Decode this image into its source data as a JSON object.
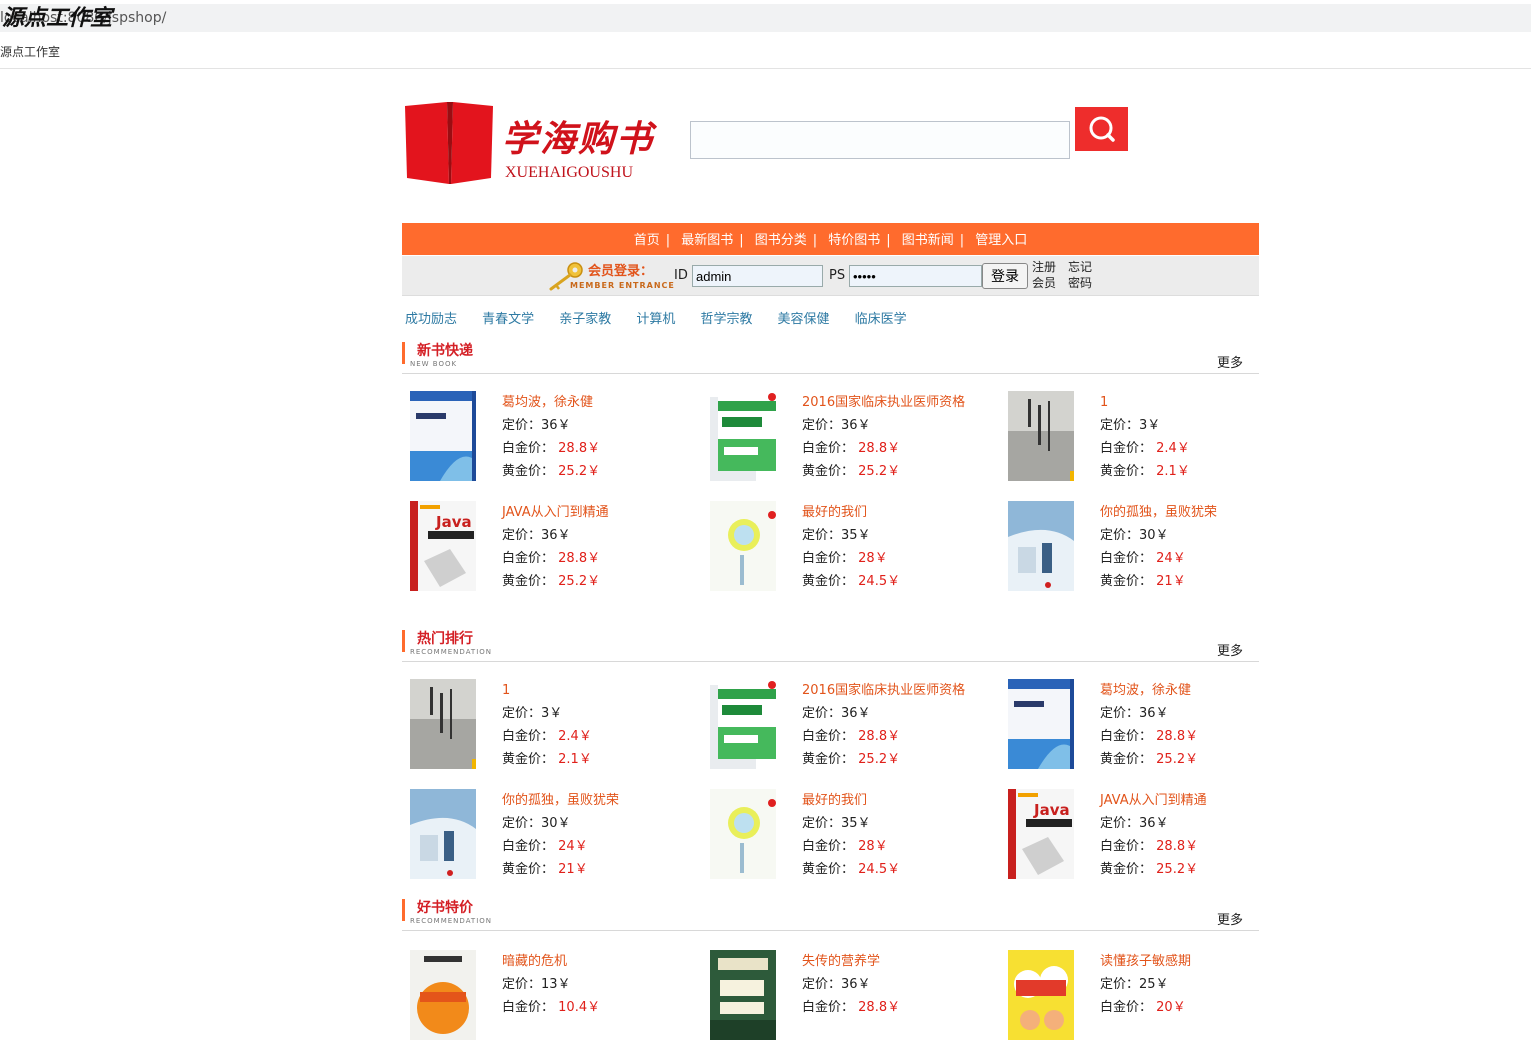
{
  "browser": {
    "url": "localhost:8080/jspshop/",
    "tab_title": "源点工作室"
  },
  "watermark": "源点工作室",
  "logo": {
    "title": "学海购书",
    "subtitle": "XUEHAIGOUSHU"
  },
  "search": {
    "value": "",
    "placeholder": ""
  },
  "nav": [
    "首页",
    "最新图书",
    "图书分类",
    "特价图书",
    "图书新闻",
    "管理入口"
  ],
  "nav_sep": "|",
  "login": {
    "title": "会员登录：",
    "subtitle": "MEMBER ENTRANCE",
    "id_label": "ID",
    "id_value": "admin",
    "ps_label": "PS",
    "ps_value": "•••••",
    "button": "登录",
    "register": "注册会员",
    "forgot": "忘记密码"
  },
  "categories": [
    "成功励志",
    "青春文学",
    "亲子家教",
    "计算机",
    "哲学宗教",
    "美容保健",
    "临床医学"
  ],
  "labels": {
    "price": "定价：",
    "platinum": "白金价：",
    "gold": "黄金价：",
    "more": "更多"
  },
  "sections": [
    {
      "title": "新书快递",
      "subtitle": "NEW BOOK",
      "items": [
        {
          "name": "葛均波，徐永健",
          "price": "36￥",
          "platinum": "28.8￥",
          "gold": "25.2￥",
          "cover": "medical-blue"
        },
        {
          "name": "2016国家临床执业医师资格",
          "price": "36￥",
          "platinum": "28.8￥",
          "gold": "25.2￥",
          "cover": "green-exam"
        },
        {
          "name": "1",
          "price": "3￥",
          "platinum": "2.4￥",
          "gold": "2.1￥",
          "cover": "gray"
        },
        {
          "name": "JAVA从入门到精通",
          "price": "36￥",
          "platinum": "28.8￥",
          "gold": "25.2￥",
          "cover": "java"
        },
        {
          "name": "最好的我们",
          "price": "35￥",
          "platinum": "28￥",
          "gold": "24.5￥",
          "cover": "white-yellow"
        },
        {
          "name": "你的孤独，虽败犹荣",
          "price": "30￥",
          "platinum": "24￥",
          "gold": "21￥",
          "cover": "light-blue"
        }
      ]
    },
    {
      "title": "热门排行",
      "subtitle": "RECOMMENDATION",
      "items": [
        {
          "name": "1",
          "price": "3￥",
          "platinum": "2.4￥",
          "gold": "2.1￥",
          "cover": "gray"
        },
        {
          "name": "2016国家临床执业医师资格",
          "price": "36￥",
          "platinum": "28.8￥",
          "gold": "25.2￥",
          "cover": "green-exam"
        },
        {
          "name": "葛均波，徐永健",
          "price": "36￥",
          "platinum": "28.8￥",
          "gold": "25.2￥",
          "cover": "medical-blue"
        },
        {
          "name": "你的孤独，虽败犹荣",
          "price": "30￥",
          "platinum": "24￥",
          "gold": "21￥",
          "cover": "light-blue"
        },
        {
          "name": "最好的我们",
          "price": "35￥",
          "platinum": "28￥",
          "gold": "24.5￥",
          "cover": "white-yellow"
        },
        {
          "name": "JAVA从入门到精通",
          "price": "36￥",
          "platinum": "28.8￥",
          "gold": "25.2￥",
          "cover": "java"
        }
      ]
    },
    {
      "title": "好书特价",
      "subtitle": "RECOMMENDATION",
      "items": [
        {
          "name": "暗藏的危机",
          "price": "13￥",
          "platinum": "10.4￥",
          "gold": "",
          "cover": "orange-crisis"
        },
        {
          "name": "失传的营养学",
          "price": "36￥",
          "platinum": "28.8￥",
          "gold": "",
          "cover": "dark-green"
        },
        {
          "name": "读懂孩子敏感期",
          "price": "25￥",
          "platinum": "20￥",
          "gold": "",
          "cover": "yellow-kids"
        }
      ]
    }
  ],
  "colors": {
    "accent": "#ff6b2d",
    "price_red": "#e0201a",
    "title_orange": "#e2541b",
    "link_blue": "#2e7aa3"
  }
}
